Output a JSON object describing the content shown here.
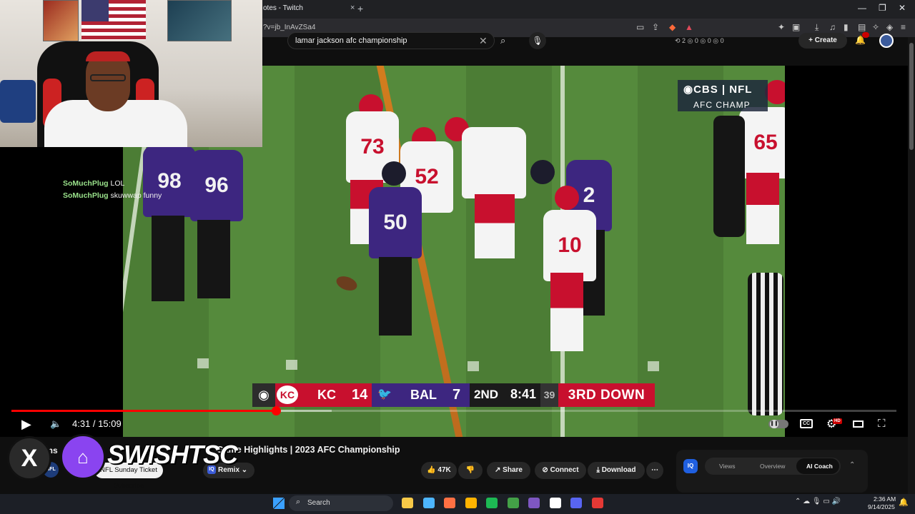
{
  "browser": {
    "tab_title": "otes - Twitch",
    "tab_close": "×",
    "new_tab": "+",
    "url": "?v=jb_InAvZSa4",
    "window_controls": [
      "—",
      "❐",
      "✕"
    ]
  },
  "youtube_header": {
    "search_query": "lamar jackson afc championship",
    "clear_icon": "✕",
    "search_icon": "⌕",
    "mic_icon": "🎙",
    "extension_stats": "⟲ 2  ◎ 0  ◎ 0  ◎ 0",
    "create_label": "+ Create",
    "bell_icon": "🔔"
  },
  "broadcast": {
    "network_logo": "◉CBS | NFL",
    "network_sub": "AFC CHAMP"
  },
  "jerseys": [
    "98",
    "96",
    "73",
    "52",
    "50",
    "10",
    "2",
    "65"
  ],
  "scoreboard": {
    "network_icon": "◉",
    "away_logo": "KC",
    "away_team": "KC",
    "away_score": "14",
    "home_logo": "🐦",
    "home_team": "BAL",
    "home_score": "7",
    "quarter": "2ND",
    "clock": "8:41",
    "play_clock": "39",
    "down": "3RD DOWN"
  },
  "player_controls": {
    "play_icon": "▶",
    "volume_icon": "🔈",
    "time": "4:31 / 15:09",
    "progress_fraction": 0.299,
    "buffer_fraction": 0.362,
    "autoplay_icon": "❚❚",
    "cc_label": "CC",
    "settings_icon": "⚙",
    "hd_label": "HD",
    "fullscreen_icon": "⛶"
  },
  "video_info": {
    "title_fragment": "ans",
    "title": "Game Highlights | 2023 AFC Championship",
    "channel_icon_text": "NFL",
    "subscribe_label": "NFL Sunday Ticket  Subscribe",
    "remix_icon": "IQ",
    "remix_label": "Remix  ⌄",
    "like_label": "👍 47K",
    "dislike_label": "👎",
    "share_label": "↗ Share",
    "connect_label": "⊘ Connect",
    "download_label": "⤓ Download",
    "more_label": "⋯"
  },
  "iq_panel": {
    "logo": "IQ",
    "tabs": [
      "Views",
      "Overview",
      "AI Coach"
    ],
    "collapse_icon": "⌃"
  },
  "chat": [
    {
      "user": "SoMuchPlug",
      "message": "LOL"
    },
    {
      "user": "SoMuchPlug",
      "message": "skuwwap funny"
    }
  ],
  "socials": {
    "x_icon": "X",
    "twitch_icon": "⌂",
    "handle": "SWISHTSC"
  },
  "taskbar": {
    "search_icon": "⌕",
    "search_label": "Search",
    "clock_time": "2:36 AM",
    "clock_date": "9/14/2025",
    "tray_icons": "⌃  ☁  🎙  ▭  🔊",
    "notification_icon": "🔔",
    "app_colors": [
      "#f7c948",
      "#4db6ff",
      "#ff7043",
      "#ffb300",
      "#1db954",
      "#43a047",
      "#7e57c2",
      "#ffffff",
      "#5865f2",
      "#e53935"
    ]
  },
  "colors": {
    "youtube_red": "#ff0000",
    "chiefs_red": "#c8102e",
    "ravens_purple": "#3d2680",
    "twitch_purple": "#8a44f0",
    "chat_green": "#9be38c"
  }
}
